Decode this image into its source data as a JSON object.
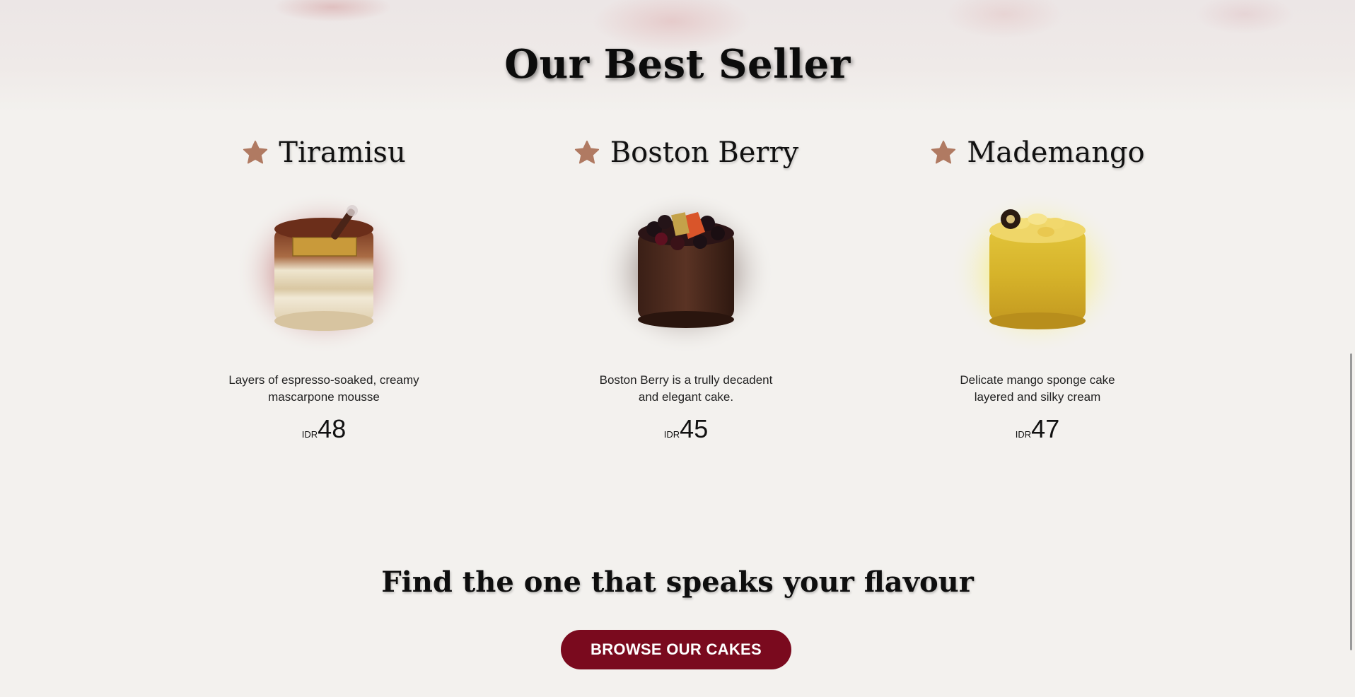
{
  "section": {
    "title": "Our Best Seller"
  },
  "products": [
    {
      "name": "Tiramisu",
      "description": "Layers of espresso-soaked, creamy mascarpone mousse",
      "currency": "IDR",
      "price": "48",
      "glow_color": "#b76a6a",
      "icon": "star-icon"
    },
    {
      "name": "Boston Berry",
      "description": "Boston Berry is a trully decadent and elegant cake.",
      "currency": "IDR",
      "price": "45",
      "glow_color": "#6e5a55",
      "icon": "star-icon"
    },
    {
      "name": "Mademango",
      "description": "Delicate mango sponge cake layered and silky cream",
      "currency": "IDR",
      "price": "47",
      "glow_color": "#f2ea4a",
      "icon": "star-icon"
    }
  ],
  "tagline": "Find the one that speaks your flavour",
  "cta": {
    "label": "BROWSE OUR CAKES"
  },
  "colors": {
    "star": "#b07a62",
    "button": "#7a0a1e",
    "background": "#f3f1ee"
  }
}
